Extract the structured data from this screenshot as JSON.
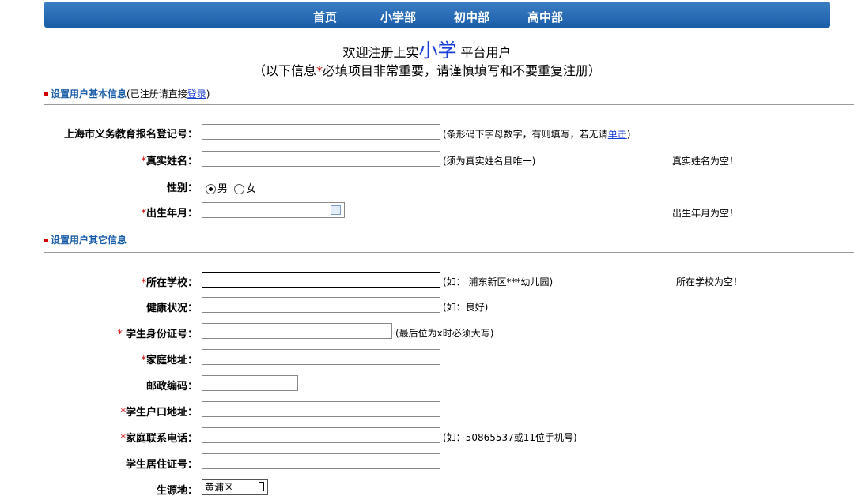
{
  "nav": {
    "items": [
      "首页",
      "小学部",
      "初中部",
      "高中部"
    ]
  },
  "header": {
    "welcome_prefix": "欢迎注册上实",
    "welcome_big": "小学",
    "welcome_suffix": " 平台用户",
    "notice_prefix": "（以下信息",
    "notice_star": "*",
    "notice_suffix": "必填项目非常重要，请谨慎填写和不要重复注册）"
  },
  "section1": {
    "title": "设置用户基本信息",
    "note_prefix": "(已注册请直接",
    "note_link": "登录",
    "note_suffix": ")"
  },
  "section2": {
    "title": "设置用户其它信息"
  },
  "fields": {
    "reg_no": {
      "label": "上海市义务教育报名登记号：",
      "hint_prefix": "(条形码下字母数字，有则填写，若无请",
      "hint_link": "单击",
      "hint_suffix": ")"
    },
    "real_name": {
      "star": "*",
      "label": "真实姓名：",
      "hint": "(须为真实姓名且唯一)",
      "error": "真实姓名为空！"
    },
    "gender": {
      "label": "性别：",
      "options": [
        "男",
        "女"
      ],
      "selected": "男"
    },
    "birth": {
      "star": "*",
      "label": "出生年月：",
      "error": "出生年月为空！"
    },
    "school": {
      "star": "*",
      "label": "所在学校：",
      "hint": "(如： 浦东新区***幼儿园)",
      "error": "所在学校为空！"
    },
    "health": {
      "label": "健康状况：",
      "hint": "(如：良好)"
    },
    "id_card": {
      "star": "* ",
      "label": "学生身份证号：",
      "hint": "(最后位为x时必须大写)"
    },
    "address": {
      "star": "*",
      "label": "家庭地址："
    },
    "postcode": {
      "label": "邮政编码："
    },
    "hukou": {
      "star": "*",
      "label": "学生户口地址："
    },
    "phone": {
      "star": "*",
      "label": "家庭联系电话：",
      "hint": "(如：50865537或11位手机号)"
    },
    "residence": {
      "label": "学生居住证号："
    },
    "origin": {
      "label": "生源地：",
      "value": "黄浦区"
    }
  }
}
